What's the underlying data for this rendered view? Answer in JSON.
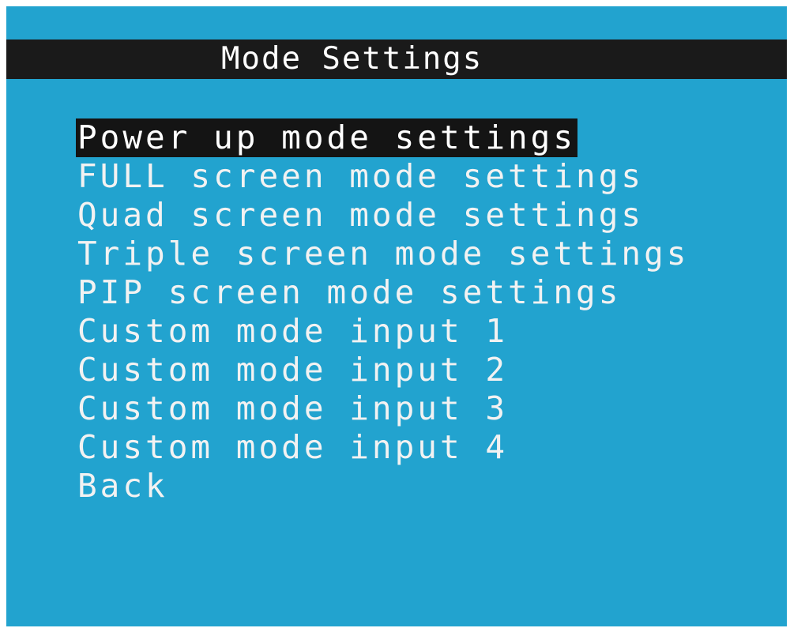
{
  "title": "Mode Settings",
  "colors": {
    "screen_background": "#22a3cf",
    "title_bar": "#1a1a1a",
    "selection_highlight": "#141414",
    "text": "#ffffff"
  },
  "menu": {
    "selected_index": 0,
    "items": [
      {
        "label": "Power up mode settings"
      },
      {
        "label": "FULL screen mode settings"
      },
      {
        "label": "Quad screen mode settings"
      },
      {
        "label": "Triple screen mode settings"
      },
      {
        "label": "PIP screen mode settings"
      },
      {
        "label": "Custom mode input 1"
      },
      {
        "label": "Custom mode input 2"
      },
      {
        "label": "Custom mode input 3"
      },
      {
        "label": "Custom mode input 4"
      },
      {
        "label": "Back"
      }
    ]
  }
}
